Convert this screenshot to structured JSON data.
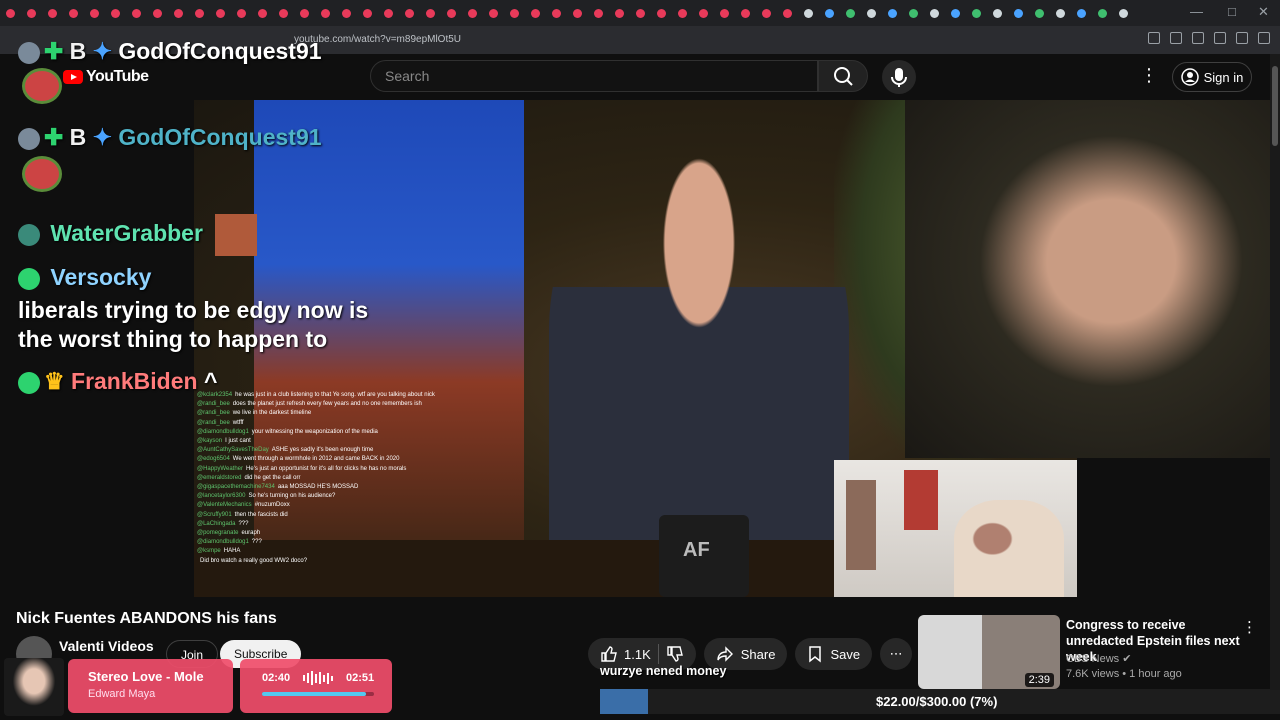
{
  "browser": {
    "url": "youtube.com/watch?v=m89epMlOt5U"
  },
  "youtube": {
    "logo_text": "YouTube",
    "search_placeholder": "Search",
    "sign_in": "Sign in"
  },
  "overlay_chat": {
    "user1": "GodOfConquest91",
    "user1_badge": "B",
    "user2": "WaterGrabber",
    "user3": "Versocky",
    "message": "liberals trying to be edgy now is the worst thing to happen to",
    "user4": "FrankBiden",
    "user4_msg": "^"
  },
  "small_chat": [
    {
      "user": "@kclark2354",
      "text": "he was just in a club listening to that Ye song. wtf are you talking about nick"
    },
    {
      "user": "@randi_bee",
      "text": "does the planet just refresh every few years and no one remembers ish"
    },
    {
      "user": "@randi_bee",
      "text": "we live in the darkest timeline"
    },
    {
      "user": "@randi_bee",
      "text": "wtfff"
    },
    {
      "user": "@diamondbulldog1",
      "text": "your witnessing the weaponization of the media"
    },
    {
      "user": "@kayson",
      "text": "I just cant"
    },
    {
      "user": "@AuntCathySavesTheDay",
      "text": "ASHE yes sadly it's been enough time"
    },
    {
      "user": "@edog6504",
      "text": "We went through a wormhole in 2012 and came BACK in 2020"
    },
    {
      "user": "@HappyWeather",
      "text": "He's just an opportunist for it's all for clicks he has no morals"
    },
    {
      "user": "@emeraldstored",
      "text": "did he get the call orr"
    },
    {
      "user": "@gigaspacethemachine7434",
      "text": "aaa MOSSAD HE'S MOSSAD"
    },
    {
      "user": "@lancetaylor6300",
      "text": "So he's turning on his audience?"
    },
    {
      "user": "@ValenteMechanics",
      "text": "#nuzumDoxx"
    },
    {
      "user": "@Scruffy901",
      "text": "then the fascists did"
    },
    {
      "user": "@LaChingada",
      "text": "???"
    },
    {
      "user": "@pomegranate",
      "text": "euraph"
    },
    {
      "user": "@diamondbulldog1",
      "text": "???"
    },
    {
      "user": "@ksmpe",
      "text": "HAHA"
    },
    {
      "user": "",
      "text": "Did bro watch a really good WW2 doco?"
    }
  ],
  "mug_text": "AF",
  "video": {
    "title": "Nick Fuentes ABANDONS his fans",
    "channel": "Valenti Videos",
    "join": "Join",
    "subscribe": "Subscribe",
    "likes": "1.1K",
    "share": "Share",
    "save": "Save"
  },
  "recommendation": {
    "title": "Congress to receive unredacted Epstein files next week",
    "channel": "CBS News",
    "views": "7.6K views",
    "age": "1 hour ago",
    "duration": "2:39"
  },
  "music_widget": {
    "song": "Stereo Love - Mole",
    "artist": "Edward Maya",
    "current": "02:40",
    "total": "02:51",
    "progress": 0.93
  },
  "caption": "wurzye nened money",
  "donation_goal": {
    "text": "$22.00/$300.00 (7%)",
    "progress": 0.07
  },
  "colors": {
    "accent_red": "#ff0000",
    "music_pink": "#f04d6a",
    "goal_blue": "#3a6ea8",
    "chat_green": "#5ec46d"
  }
}
